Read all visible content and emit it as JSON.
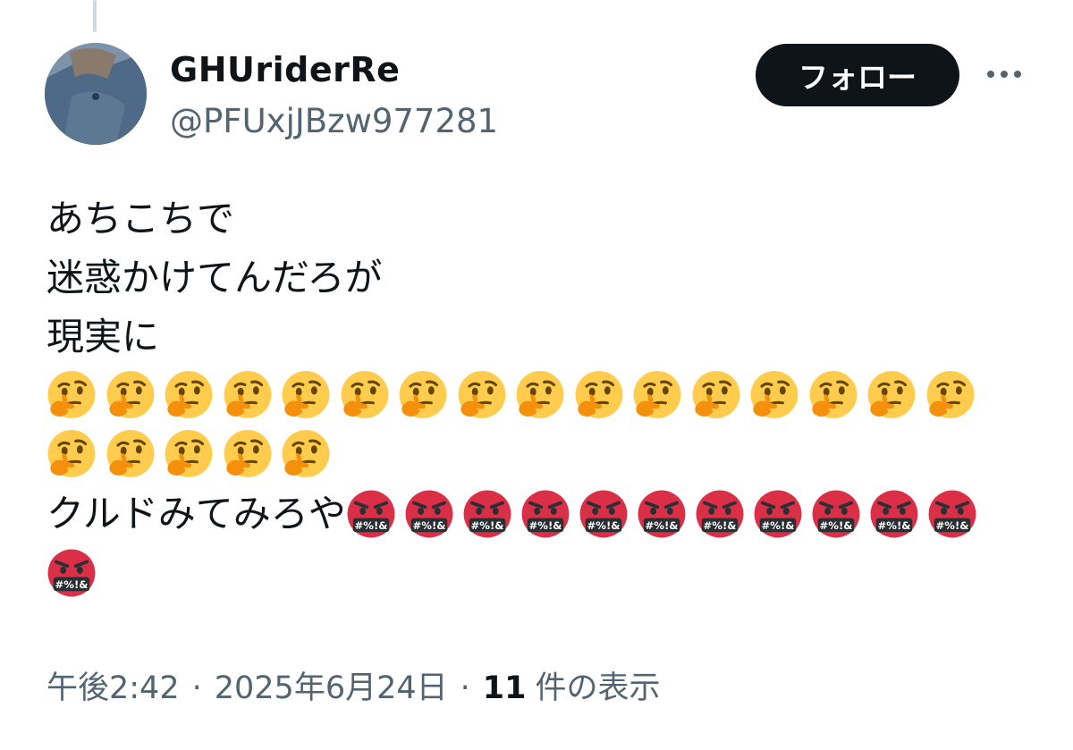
{
  "author": {
    "display_name": "GHUriderRe",
    "handle": "@PFUxjJBzw977281"
  },
  "actions": {
    "follow_label": "フォロー",
    "more_icon": "more-horizontal-icon"
  },
  "tweet": {
    "lines": [
      "あちこちで",
      "迷惑かけてんだろが",
      "現実に"
    ],
    "thinking_emoji_count_row1": 16,
    "thinking_emoji_count_row2": 5,
    "line6_text": "クルドみてみろや",
    "angry_emoji_count_line6": 11,
    "angry_emoji_count_row8": 1,
    "thinking_emoji": "thinking-face-emoji",
    "angry_emoji": "face-with-symbols-on-mouth-emoji"
  },
  "meta": {
    "time": "午後2:42",
    "separator": "·",
    "date": "2025年6月24日",
    "views_count": "11",
    "views_label": "件の表示"
  },
  "colors": {
    "follow_bg": "#0f1419",
    "secondary_text": "#536471",
    "thinking_face": "#ffcc4d",
    "thinking_hand": "#f4900c",
    "angry_face": "#da2f47"
  }
}
